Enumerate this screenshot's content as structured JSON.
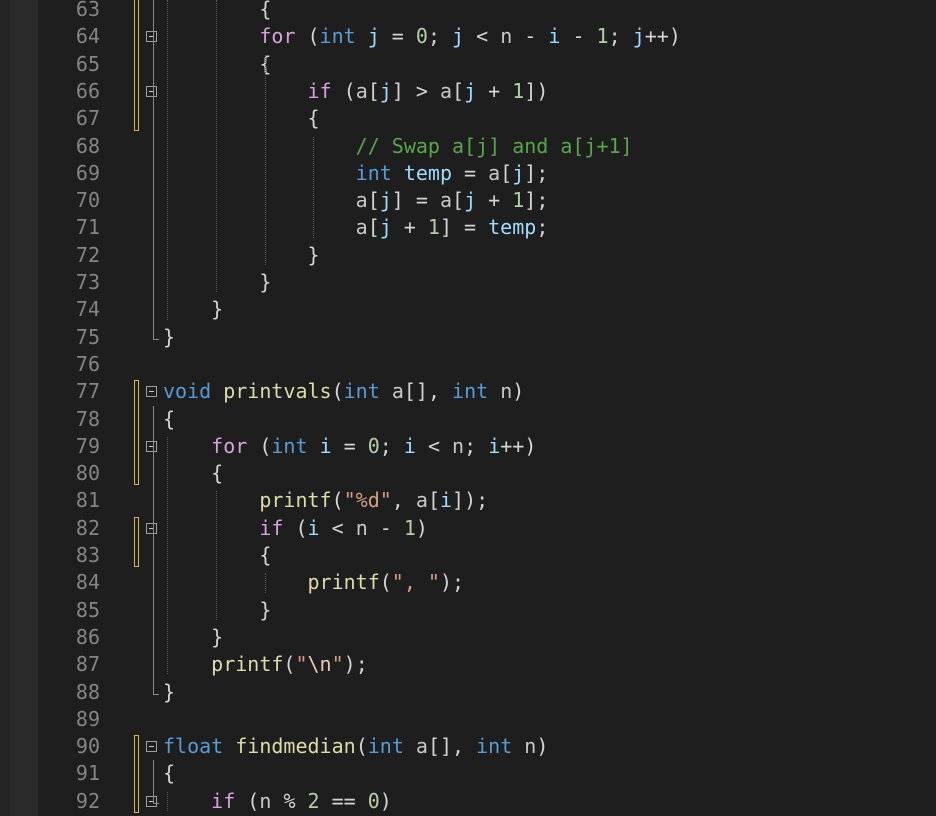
{
  "editor": {
    "language": "c",
    "colors": {
      "background": "#1e1e1e",
      "keyword": "#569cd6",
      "control": "#d8a0df",
      "function": "#dcdcaa",
      "variable": "#9cdcfe",
      "string": "#d69d85",
      "number": "#b5cea8",
      "comment": "#57a64a",
      "line_number": "#858585",
      "modified_marker": "#d7ba3d"
    },
    "lines": [
      {
        "num": "63",
        "tokens": [
          {
            "t": "        {",
            "c": "punc"
          }
        ]
      },
      {
        "num": "64",
        "tokens": [
          {
            "t": "        ",
            "c": "punc"
          },
          {
            "t": "for",
            "c": "ctl"
          },
          {
            "t": " (",
            "c": "punc"
          },
          {
            "t": "int",
            "c": "kw"
          },
          {
            "t": " ",
            "c": "punc"
          },
          {
            "t": "j",
            "c": "var"
          },
          {
            "t": " = ",
            "c": "punc"
          },
          {
            "t": "0",
            "c": "num"
          },
          {
            "t": "; ",
            "c": "punc"
          },
          {
            "t": "j",
            "c": "var"
          },
          {
            "t": " < ",
            "c": "punc"
          },
          {
            "t": "n",
            "c": "par"
          },
          {
            "t": " - ",
            "c": "punc"
          },
          {
            "t": "i",
            "c": "var"
          },
          {
            "t": " - ",
            "c": "punc"
          },
          {
            "t": "1",
            "c": "num"
          },
          {
            "t": "; ",
            "c": "punc"
          },
          {
            "t": "j",
            "c": "var"
          },
          {
            "t": "++)",
            "c": "punc"
          }
        ]
      },
      {
        "num": "65",
        "tokens": [
          {
            "t": "        {",
            "c": "punc"
          }
        ]
      },
      {
        "num": "66",
        "tokens": [
          {
            "t": "            ",
            "c": "punc"
          },
          {
            "t": "if",
            "c": "ctl"
          },
          {
            "t": " (",
            "c": "punc"
          },
          {
            "t": "a",
            "c": "par"
          },
          {
            "t": "[",
            "c": "punc"
          },
          {
            "t": "j",
            "c": "var"
          },
          {
            "t": "] > ",
            "c": "punc"
          },
          {
            "t": "a",
            "c": "par"
          },
          {
            "t": "[",
            "c": "punc"
          },
          {
            "t": "j",
            "c": "var"
          },
          {
            "t": " + ",
            "c": "punc"
          },
          {
            "t": "1",
            "c": "num"
          },
          {
            "t": "])",
            "c": "punc"
          }
        ]
      },
      {
        "num": "67",
        "tokens": [
          {
            "t": "            {",
            "c": "punc"
          }
        ]
      },
      {
        "num": "68",
        "tokens": [
          {
            "t": "                ",
            "c": "punc"
          },
          {
            "t": "// Swap a[j] and a[j+1]",
            "c": "cmt"
          }
        ]
      },
      {
        "num": "69",
        "tokens": [
          {
            "t": "                ",
            "c": "punc"
          },
          {
            "t": "int",
            "c": "kw"
          },
          {
            "t": " ",
            "c": "punc"
          },
          {
            "t": "temp",
            "c": "var"
          },
          {
            "t": " = ",
            "c": "punc"
          },
          {
            "t": "a",
            "c": "par"
          },
          {
            "t": "[",
            "c": "punc"
          },
          {
            "t": "j",
            "c": "var"
          },
          {
            "t": "];",
            "c": "punc"
          }
        ]
      },
      {
        "num": "70",
        "tokens": [
          {
            "t": "                ",
            "c": "punc"
          },
          {
            "t": "a",
            "c": "par"
          },
          {
            "t": "[",
            "c": "punc"
          },
          {
            "t": "j",
            "c": "var"
          },
          {
            "t": "] = ",
            "c": "punc"
          },
          {
            "t": "a",
            "c": "par"
          },
          {
            "t": "[",
            "c": "punc"
          },
          {
            "t": "j",
            "c": "var"
          },
          {
            "t": " + ",
            "c": "punc"
          },
          {
            "t": "1",
            "c": "num"
          },
          {
            "t": "];",
            "c": "punc"
          }
        ]
      },
      {
        "num": "71",
        "tokens": [
          {
            "t": "                ",
            "c": "punc"
          },
          {
            "t": "a",
            "c": "par"
          },
          {
            "t": "[",
            "c": "punc"
          },
          {
            "t": "j",
            "c": "var"
          },
          {
            "t": " + ",
            "c": "punc"
          },
          {
            "t": "1",
            "c": "num"
          },
          {
            "t": "] = ",
            "c": "punc"
          },
          {
            "t": "temp",
            "c": "var"
          },
          {
            "t": ";",
            "c": "punc"
          }
        ]
      },
      {
        "num": "72",
        "tokens": [
          {
            "t": "            }",
            "c": "punc"
          }
        ]
      },
      {
        "num": "73",
        "tokens": [
          {
            "t": "        }",
            "c": "punc"
          }
        ]
      },
      {
        "num": "74",
        "tokens": [
          {
            "t": "    }",
            "c": "punc"
          }
        ]
      },
      {
        "num": "75",
        "tokens": [
          {
            "t": "}",
            "c": "punc"
          }
        ]
      },
      {
        "num": "76",
        "tokens": []
      },
      {
        "num": "77",
        "tokens": [
          {
            "t": "void",
            "c": "kw"
          },
          {
            "t": " ",
            "c": "punc"
          },
          {
            "t": "printvals",
            "c": "fn"
          },
          {
            "t": "(",
            "c": "punc"
          },
          {
            "t": "int",
            "c": "kw"
          },
          {
            "t": " ",
            "c": "punc"
          },
          {
            "t": "a",
            "c": "par"
          },
          {
            "t": "[], ",
            "c": "punc"
          },
          {
            "t": "int",
            "c": "kw"
          },
          {
            "t": " ",
            "c": "punc"
          },
          {
            "t": "n",
            "c": "par"
          },
          {
            "t": ")",
            "c": "punc"
          }
        ]
      },
      {
        "num": "78",
        "tokens": [
          {
            "t": "{",
            "c": "punc"
          }
        ]
      },
      {
        "num": "79",
        "tokens": [
          {
            "t": "    ",
            "c": "punc"
          },
          {
            "t": "for",
            "c": "ctl"
          },
          {
            "t": " (",
            "c": "punc"
          },
          {
            "t": "int",
            "c": "kw"
          },
          {
            "t": " ",
            "c": "punc"
          },
          {
            "t": "i",
            "c": "var"
          },
          {
            "t": " = ",
            "c": "punc"
          },
          {
            "t": "0",
            "c": "num"
          },
          {
            "t": "; ",
            "c": "punc"
          },
          {
            "t": "i",
            "c": "var"
          },
          {
            "t": " < ",
            "c": "punc"
          },
          {
            "t": "n",
            "c": "par"
          },
          {
            "t": "; ",
            "c": "punc"
          },
          {
            "t": "i",
            "c": "var"
          },
          {
            "t": "++)",
            "c": "punc"
          }
        ]
      },
      {
        "num": "80",
        "tokens": [
          {
            "t": "    {",
            "c": "punc"
          }
        ]
      },
      {
        "num": "81",
        "tokens": [
          {
            "t": "        ",
            "c": "punc"
          },
          {
            "t": "printf",
            "c": "fn"
          },
          {
            "t": "(",
            "c": "punc"
          },
          {
            "t": "\"%d\"",
            "c": "str"
          },
          {
            "t": ", ",
            "c": "punc"
          },
          {
            "t": "a",
            "c": "par"
          },
          {
            "t": "[",
            "c": "punc"
          },
          {
            "t": "i",
            "c": "var"
          },
          {
            "t": "]);",
            "c": "punc"
          }
        ]
      },
      {
        "num": "82",
        "tokens": [
          {
            "t": "        ",
            "c": "punc"
          },
          {
            "t": "if",
            "c": "ctl"
          },
          {
            "t": " (",
            "c": "punc"
          },
          {
            "t": "i",
            "c": "var"
          },
          {
            "t": " < ",
            "c": "punc"
          },
          {
            "t": "n",
            "c": "par"
          },
          {
            "t": " - ",
            "c": "punc"
          },
          {
            "t": "1",
            "c": "num"
          },
          {
            "t": ")",
            "c": "punc"
          }
        ]
      },
      {
        "num": "83",
        "tokens": [
          {
            "t": "        {",
            "c": "punc"
          }
        ]
      },
      {
        "num": "84",
        "tokens": [
          {
            "t": "            ",
            "c": "punc"
          },
          {
            "t": "printf",
            "c": "fn"
          },
          {
            "t": "(",
            "c": "punc"
          },
          {
            "t": "\", \"",
            "c": "str"
          },
          {
            "t": ");",
            "c": "punc"
          }
        ]
      },
      {
        "num": "85",
        "tokens": [
          {
            "t": "        }",
            "c": "punc"
          }
        ]
      },
      {
        "num": "86",
        "tokens": [
          {
            "t": "    }",
            "c": "punc"
          }
        ]
      },
      {
        "num": "87",
        "tokens": [
          {
            "t": "    ",
            "c": "punc"
          },
          {
            "t": "printf",
            "c": "fn"
          },
          {
            "t": "(",
            "c": "punc"
          },
          {
            "t": "\"",
            "c": "str"
          },
          {
            "t": "\\n",
            "c": "esc"
          },
          {
            "t": "\"",
            "c": "str"
          },
          {
            "t": ");",
            "c": "punc"
          }
        ]
      },
      {
        "num": "88",
        "tokens": [
          {
            "t": "}",
            "c": "punc"
          }
        ]
      },
      {
        "num": "89",
        "tokens": []
      },
      {
        "num": "90",
        "tokens": [
          {
            "t": "float",
            "c": "kw"
          },
          {
            "t": " ",
            "c": "punc"
          },
          {
            "t": "findmedian",
            "c": "fn"
          },
          {
            "t": "(",
            "c": "punc"
          },
          {
            "t": "int",
            "c": "kw"
          },
          {
            "t": " ",
            "c": "punc"
          },
          {
            "t": "a",
            "c": "par"
          },
          {
            "t": "[], ",
            "c": "punc"
          },
          {
            "t": "int",
            "c": "kw"
          },
          {
            "t": " ",
            "c": "punc"
          },
          {
            "t": "n",
            "c": "par"
          },
          {
            "t": ")",
            "c": "punc"
          }
        ]
      },
      {
        "num": "91",
        "tokens": [
          {
            "t": "{",
            "c": "punc"
          }
        ]
      },
      {
        "num": "92",
        "tokens": [
          {
            "t": "    ",
            "c": "punc"
          },
          {
            "t": "if",
            "c": "ctl"
          },
          {
            "t": " (",
            "c": "punc"
          },
          {
            "t": "n",
            "c": "par"
          },
          {
            "t": " % ",
            "c": "punc"
          },
          {
            "t": "2",
            "c": "num"
          },
          {
            "t": " == ",
            "c": "punc"
          },
          {
            "t": "0",
            "c": "num"
          },
          {
            "t": ")",
            "c": "punc"
          }
        ]
      }
    ],
    "fold_lines": [
      "64",
      "66",
      "77",
      "79",
      "82",
      "90",
      "92"
    ]
  }
}
